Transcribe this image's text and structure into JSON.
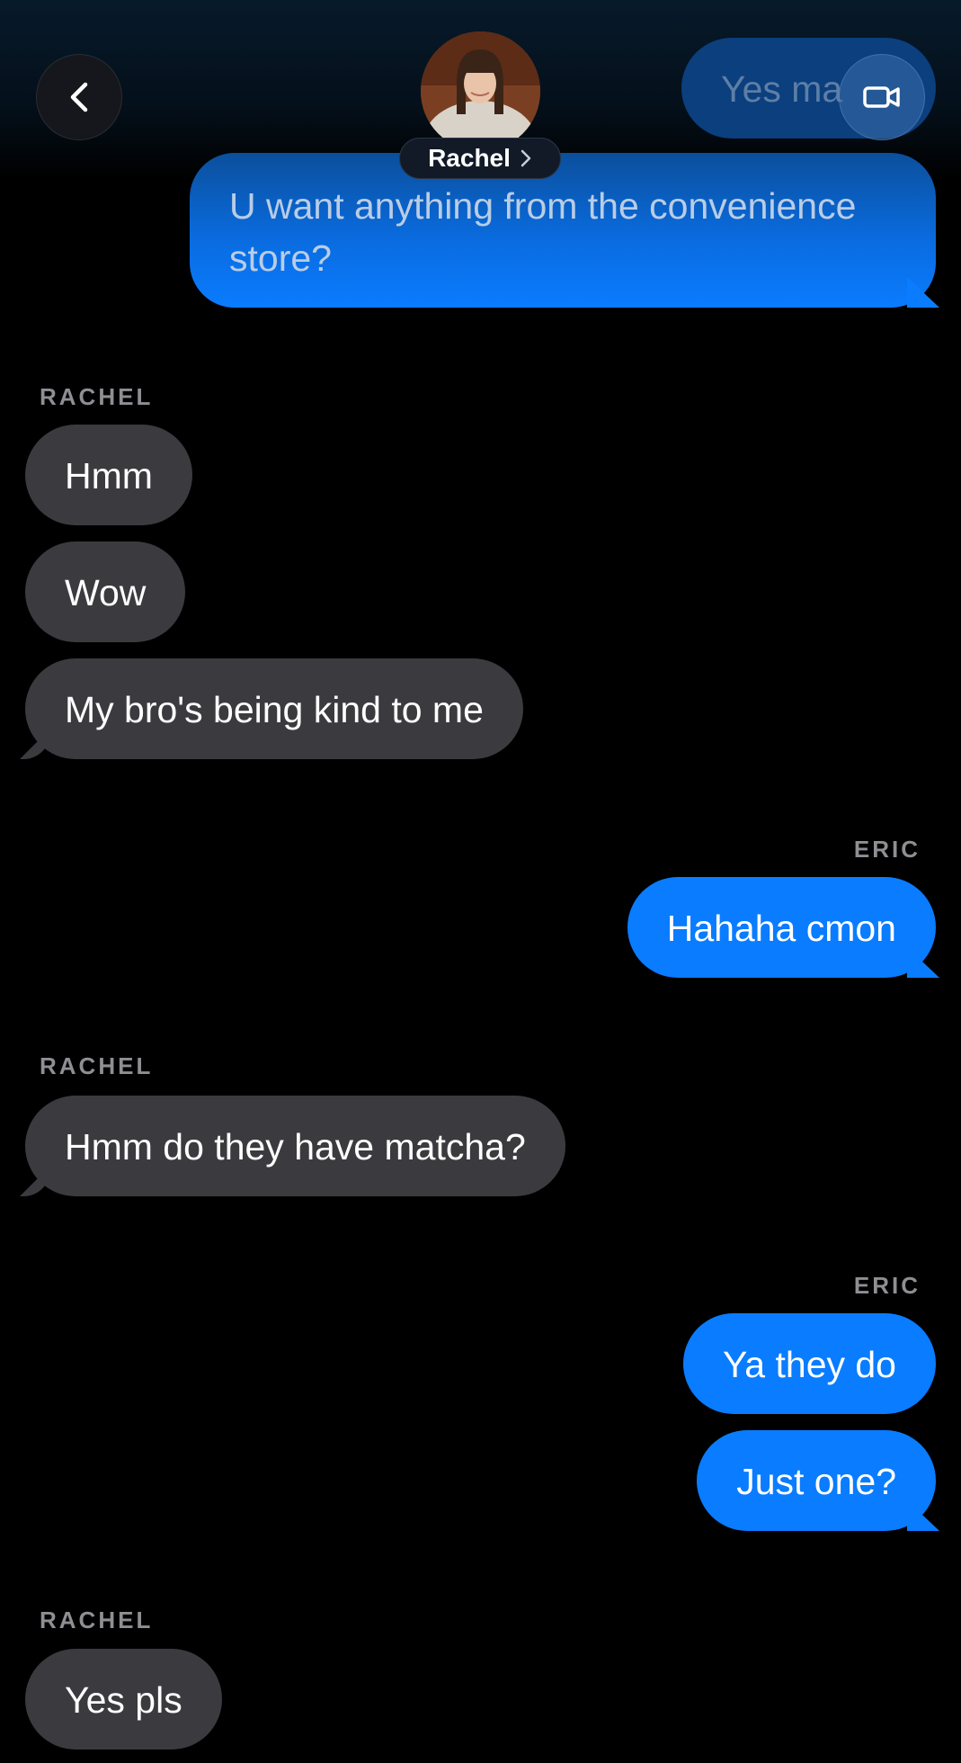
{
  "header": {
    "contact_name": "Rachel",
    "back_icon": "chevron-left-icon",
    "video_icon": "video-camera-icon",
    "chevron_icon": "chevron-right-icon"
  },
  "colors": {
    "background": "#000000",
    "incoming_bubble": "#3b3b3f",
    "outgoing_bubble": "#0a7cff",
    "sender_label": "#8e8e93"
  },
  "messages": [
    {
      "direction": "out",
      "text": "Yes ma"
    },
    {
      "direction": "out",
      "text": "U want anything from the convenience store?"
    },
    {
      "direction": "in",
      "sender": "RACHEL",
      "text": "Hmm"
    },
    {
      "direction": "in",
      "text": "Wow"
    },
    {
      "direction": "in",
      "text": "My bro's being kind to me"
    },
    {
      "direction": "out",
      "sender": "ERIC",
      "text": "Hahaha cmon"
    },
    {
      "direction": "in",
      "sender": "RACHEL",
      "text": "Hmm do they have matcha?"
    },
    {
      "direction": "out",
      "sender": "ERIC",
      "text": "Ya they do"
    },
    {
      "direction": "out",
      "text": "Just one?"
    },
    {
      "direction": "in",
      "sender": "RACHEL",
      "text": "Yes pls"
    }
  ]
}
